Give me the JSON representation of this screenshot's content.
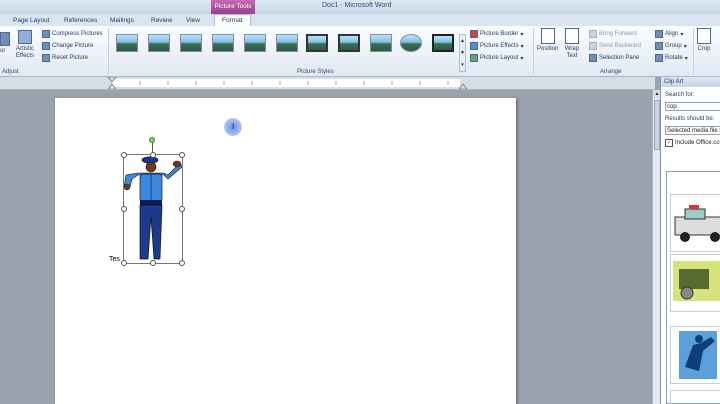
{
  "window": {
    "title": "Doc1 - Microsoft Word",
    "context_tab": "Picture Tools"
  },
  "tabs": [
    "Page Layout",
    "References",
    "Mailings",
    "Review",
    "View",
    "Format"
  ],
  "ribbon": {
    "adjust": {
      "color_frag": "or",
      "artistic_effects": "Artistic Effects",
      "compress": "Compress Pictures",
      "change": "Change Picture",
      "reset": "Reset Picture",
      "label": "Adjust"
    },
    "styles_label": "Picture Styles",
    "border": "Picture Border",
    "effects": "Picture Effects",
    "layout": "Picture Layout",
    "position": "Position",
    "wrap_text": "Wrap Text",
    "bring_forward": "Bring Forward",
    "send_backward": "Send Backward",
    "selection_pane": "Selection Pane",
    "align": "Align",
    "group": "Group",
    "rotate": "Rotate",
    "arrange_label": "Arrange",
    "crop_frag": "Crop"
  },
  "clip_art": {
    "title": "Clip Art",
    "search_label": "Search for:",
    "search_value": "cop",
    "results_label": "Results should be:",
    "results_value": "Selected media file t",
    "include_office": "Include Office.co"
  },
  "document": {
    "text_fragment": "Tes"
  }
}
